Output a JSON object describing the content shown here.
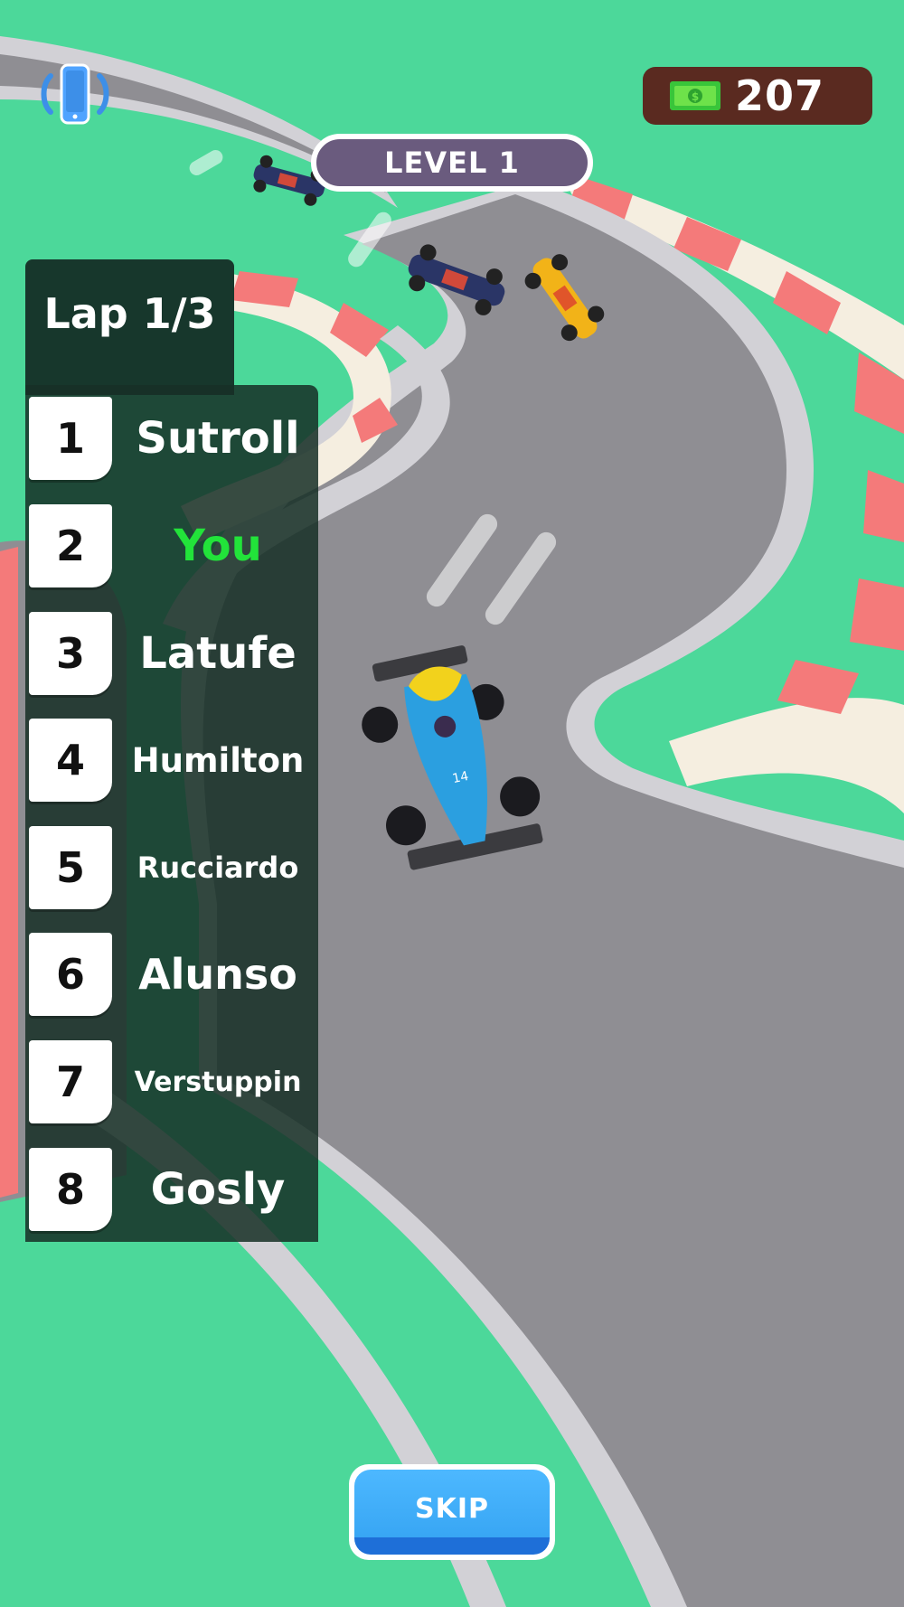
{
  "hud": {
    "cash": "207",
    "level": "LEVEL 1",
    "vibration_icon": "vibration-phone-icon",
    "cash_icon": "money-bill-icon"
  },
  "leaderboard": {
    "lap": "Lap 1/3",
    "racers": [
      {
        "pos": "1",
        "name": "Sutroll",
        "color": "#ffffff"
      },
      {
        "pos": "2",
        "name": "You",
        "color": "#22e33a"
      },
      {
        "pos": "3",
        "name": "Latufe",
        "color": "#ffffff"
      },
      {
        "pos": "4",
        "name": "Humilton",
        "color": "#ffffff"
      },
      {
        "pos": "5",
        "name": "Rucciardo",
        "color": "#ffffff"
      },
      {
        "pos": "6",
        "name": "Alunso",
        "color": "#ffffff"
      },
      {
        "pos": "7",
        "name": "Verstuppin",
        "color": "#ffffff"
      },
      {
        "pos": "8",
        "name": "Gosly",
        "color": "#ffffff"
      }
    ]
  },
  "skip": {
    "label": "SKIP"
  },
  "colors": {
    "grass": "#4cd89a",
    "track": "#8f8e93",
    "kerb_red": "#f47a7a",
    "kerb_white": "#f5eee0",
    "player_car": "#2b9fe0",
    "rival_yellow": "#f2b318",
    "rival_navy": "#2a3566"
  }
}
